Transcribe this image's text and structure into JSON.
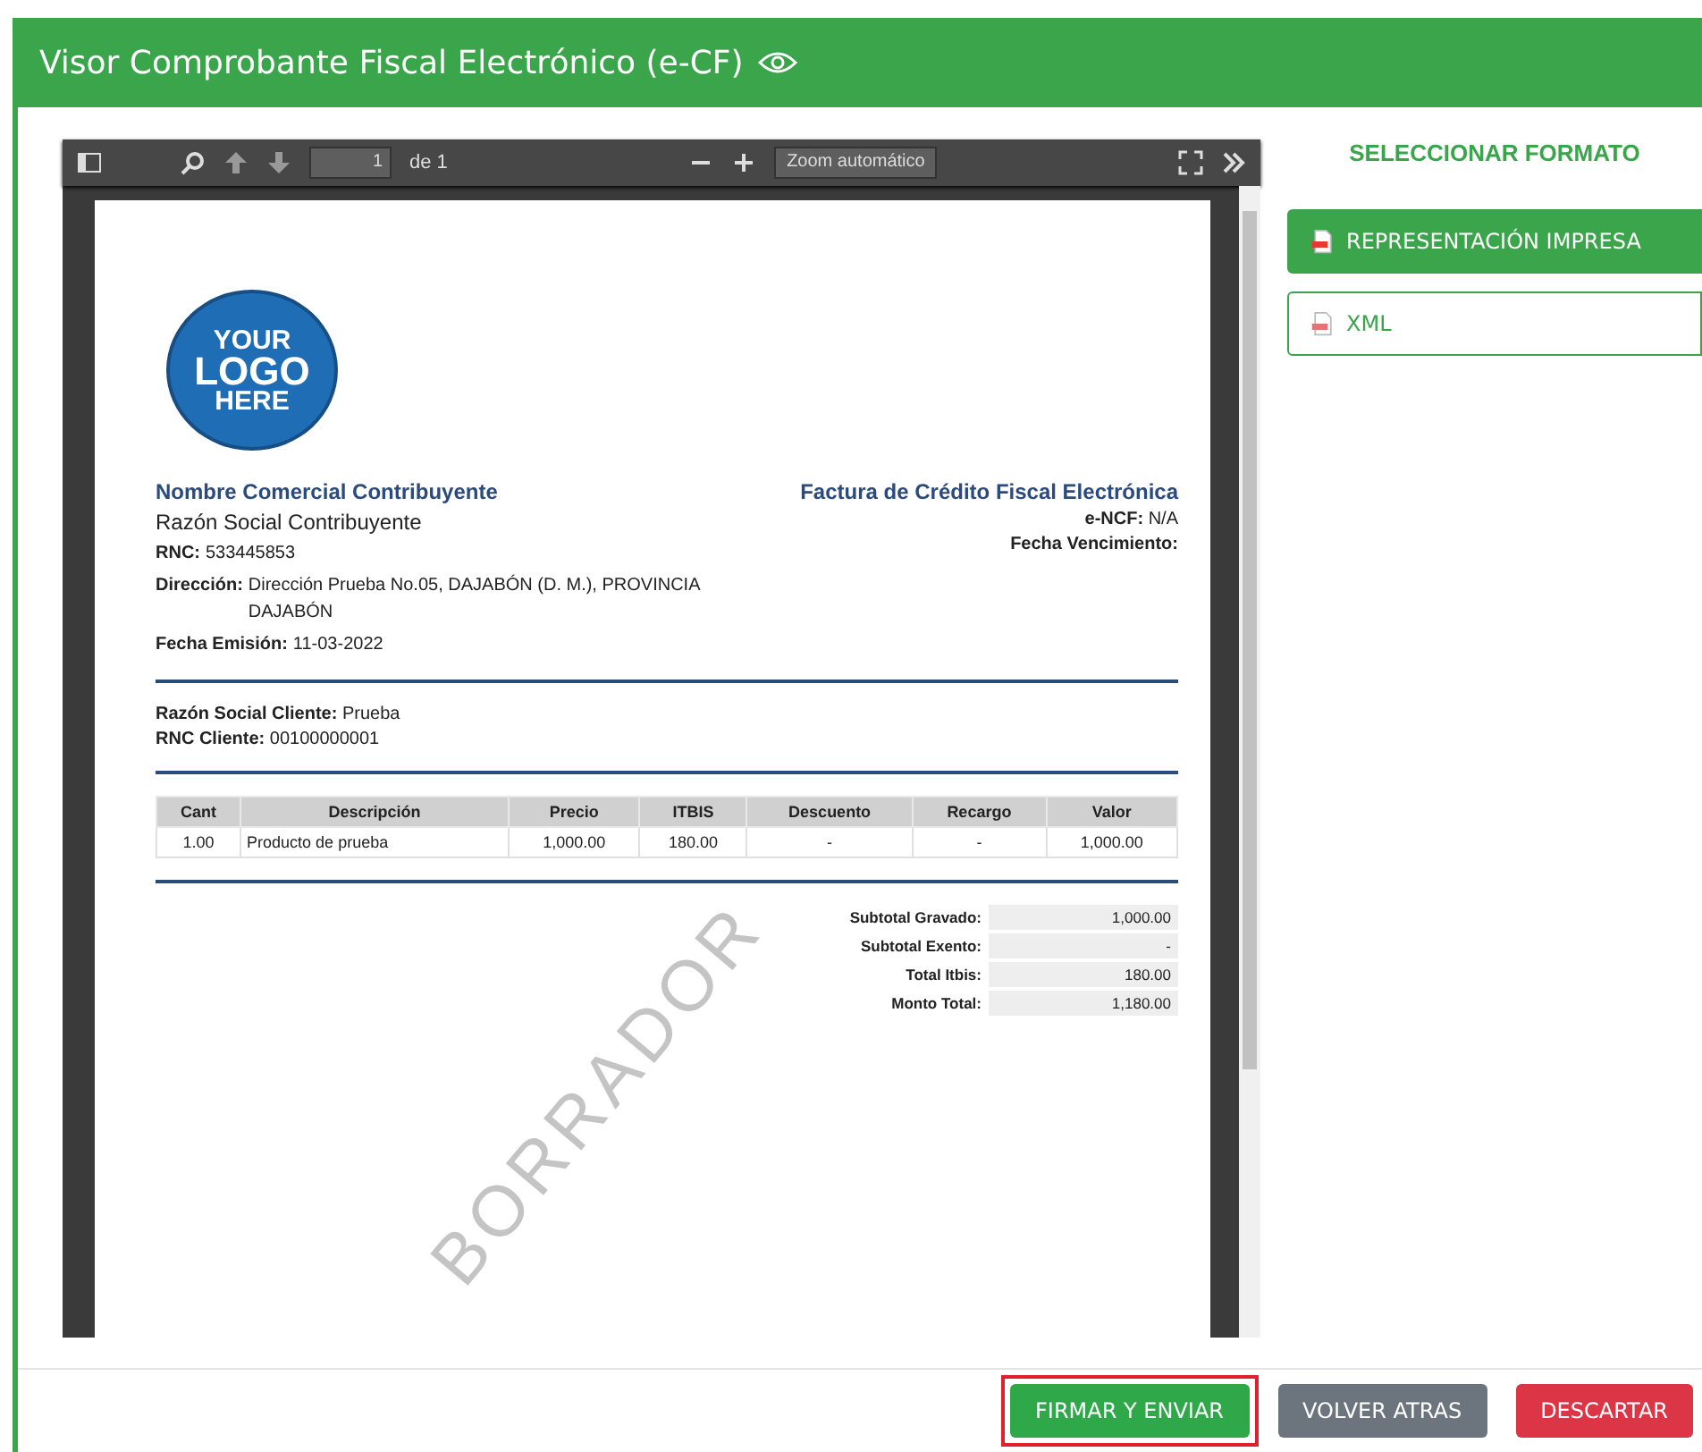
{
  "window": {
    "title": "Visor Comprobante Fiscal Electrónico (e-CF)"
  },
  "viewer": {
    "toolbar": {
      "page": "1",
      "page_total": "de 1",
      "zoom": "Zoom automático"
    },
    "document": {
      "logo": [
        "YOUR",
        "LOGO",
        "HERE"
      ],
      "watermark": "BORRADOR",
      "issuer": {
        "trade_name": "Nombre Comercial Contribuyente",
        "legal_name": "Razón Social Contribuyente",
        "fields": [
          {
            "label": "RNC:",
            "value": "533445853"
          },
          {
            "label": "Dirección:",
            "value": "Dirección Prueba No.05, DAJABÓN (D. M.), PROVINCIA DAJABÓN"
          },
          {
            "label": "Fecha Emisión:",
            "value": "11-03-2022"
          }
        ]
      },
      "doc_title": "Factura de Crédito Fiscal Electrónica",
      "doc_fields": [
        {
          "label": "e-NCF:",
          "value": "N/A"
        },
        {
          "label": "Fecha Vencimiento:"
        }
      ],
      "client": [
        {
          "label": "Razón Social Cliente:",
          "value": "Prueba"
        },
        {
          "label": "RNC Cliente:",
          "value": "00100000001"
        }
      ],
      "table": {
        "columns": [
          "Cant",
          "Descripción",
          "Precio",
          "ITBIS",
          "Descuento",
          "Recargo",
          "Valor"
        ],
        "rows": [
          [
            "1.00",
            "Producto de prueba",
            "1,000.00",
            "180.00",
            "-",
            "-",
            "1,000.00"
          ]
        ]
      },
      "totals": [
        {
          "label": "Subtotal Gravado:",
          "value": "1,000.00"
        },
        {
          "label": "Subtotal Exento:",
          "value": "-"
        },
        {
          "label": "Total Itbis:",
          "value": "180.00"
        },
        {
          "label": "Monto Total:",
          "value": "1,180.00"
        }
      ]
    }
  },
  "format_panel": {
    "title": "SELECCIONAR FORMATO",
    "formats": [
      {
        "label": "REPRESENTACIÓN IMPRESA",
        "kind": "pdf",
        "selected": true
      },
      {
        "label": "XML",
        "kind": "xml",
        "selected": false
      }
    ]
  },
  "footer": {
    "buttons": [
      {
        "label": "FIRMAR Y ENVIAR",
        "kind": "primary",
        "highlighted": true
      },
      {
        "label": "VOLVER ATRAS",
        "kind": "secondary",
        "highlighted": false
      },
      {
        "label": "DESCARTAR",
        "kind": "danger",
        "highlighted": false
      }
    ]
  }
}
